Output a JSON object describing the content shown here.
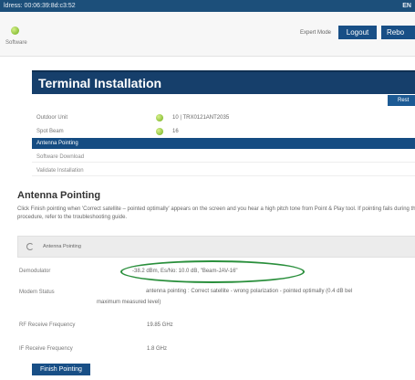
{
  "topbar": {
    "address": "ldress: 00:06:39:8d:c3:52",
    "lang": "EN"
  },
  "header": {
    "software_label": "Software",
    "expert_mode": "Expert Mode",
    "logout": "Logout",
    "reboot": "Rebo"
  },
  "page_title": "Terminal Installation",
  "restart_label": "Rest",
  "units": [
    {
      "label": "Outdoor Unit",
      "value": "10 | TRX0121ANT2035",
      "status_color": "#8fc33c"
    },
    {
      "label": "Spot Beam",
      "value": "16",
      "status_color": "#8fc33c"
    }
  ],
  "steps": [
    {
      "label": "Antenna Pointing",
      "active": true
    },
    {
      "label": "Software Download",
      "active": false
    },
    {
      "label": "Validate Installation",
      "active": false
    }
  ],
  "section": {
    "title": "Antenna Pointing",
    "instructions": "Click Finish pointing when 'Correct satellite – pointed optimally' appears on the screen and you hear a high pitch tone from Point & Play tool. If pointing fails during the procedure, refer to the troubleshooting guide."
  },
  "pointing_bar": {
    "label": "Antenna Pointing",
    "icon": "refresh-icon"
  },
  "fields": {
    "demodulator": {
      "label": "Demodulator",
      "value": "-38.2 dBm, Es/No: 10.0 dB, \"Beam-JAV-16\""
    },
    "modem_status": {
      "label": "Modem Status",
      "value_line1": "antenna pointing : Correct satellite - wrong polarization - pointed optimally (0.4 dB bel",
      "value_line2": "maximum measured level)"
    },
    "rf_freq": {
      "label": "RF Receive Frequency",
      "value": "19.85 GHz"
    },
    "if_freq": {
      "label": "IF Receive Frequency",
      "value": "1.8 GHz"
    }
  },
  "finish_button": "Finish Pointing",
  "colors": {
    "primary": "#184f86",
    "highlight_oval": "#2a8f3c",
    "status_ok": "#8fc33c"
  }
}
